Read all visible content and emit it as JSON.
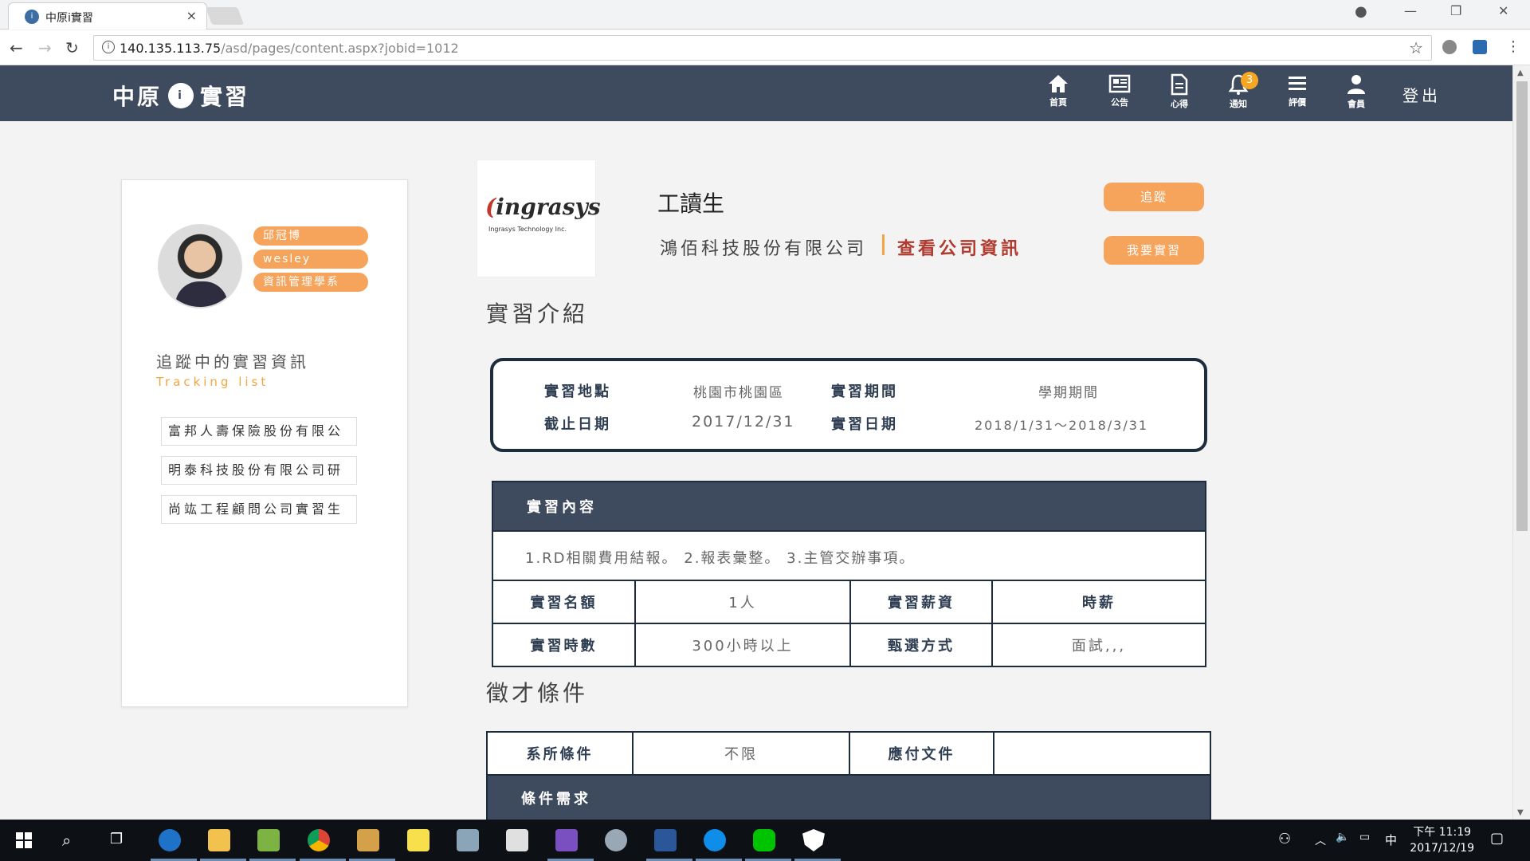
{
  "browser": {
    "tab_title": "中原i實習",
    "tab_close": "×",
    "url_host": "140.135.113.75",
    "url_path": "/asd/pages/content.aspx?jobid=1012",
    "win_minimize": "—",
    "win_restore": "❐",
    "win_close": "✕"
  },
  "site": {
    "logo_left": "中原",
    "logo_badge": "i",
    "logo_right": "實習",
    "nav": [
      {
        "label": "首頁",
        "icon": "home-icon"
      },
      {
        "label": "公告",
        "icon": "newspaper-icon"
      },
      {
        "label": "心得",
        "icon": "document-icon"
      },
      {
        "label": "通知",
        "icon": "bell-icon",
        "badge": "3"
      },
      {
        "label": "評價",
        "icon": "menu-icon"
      },
      {
        "label": "會員",
        "icon": "user-icon"
      }
    ],
    "logout": "登出"
  },
  "profile": {
    "name": "邱冠博",
    "english_name": "wesley",
    "department": "資訊管理學系",
    "tracking_title": "追蹤中的實習資訊",
    "tracking_subtitle": "Tracking list",
    "tracking_items": [
      "富邦人壽保險股份有限公",
      "明泰科技股份有限公司研",
      "尚竑工程顧問公司實習生"
    ]
  },
  "job": {
    "company_logo_text": "ingrasys",
    "company_logo_subtext": "Ingrasys Technology Inc.",
    "title": "工讀生",
    "company": "鴻佰科技股份有限公司",
    "company_link": "查看公司資訊",
    "track_button": "追蹤",
    "apply_button": "我要實習"
  },
  "intro": {
    "heading": "實習介紹",
    "location_label": "實習地點",
    "location_value": "桃園市桃園區",
    "period_label": "實習期間",
    "period_value": "學期期間",
    "deadline_label": "截止日期",
    "deadline_value": "2017/12/31",
    "dates_label": "實習日期",
    "dates_value": "2018/1/31～2018/3/31"
  },
  "content": {
    "header": "實習內容",
    "description": "1.RD相關費用結報。 2.報表彙整。 3.主管交辦事項。",
    "quota_label": "實習名額",
    "quota_value": "1人",
    "salary_label": "實習薪資",
    "salary_value": "時薪",
    "hours_label": "實習時數",
    "hours_value": "300小時以上",
    "selection_label": "甄選方式",
    "selection_value": "面試,,,"
  },
  "requirements": {
    "heading": "徵才條件",
    "dept_label": "系所條件",
    "dept_value": "不限",
    "docs_label": "應付文件",
    "docs_value": "",
    "needs_header": "條件需求"
  },
  "taskbar": {
    "ime": "中",
    "time": "下午 11:19",
    "date": "2017/12/19"
  }
}
